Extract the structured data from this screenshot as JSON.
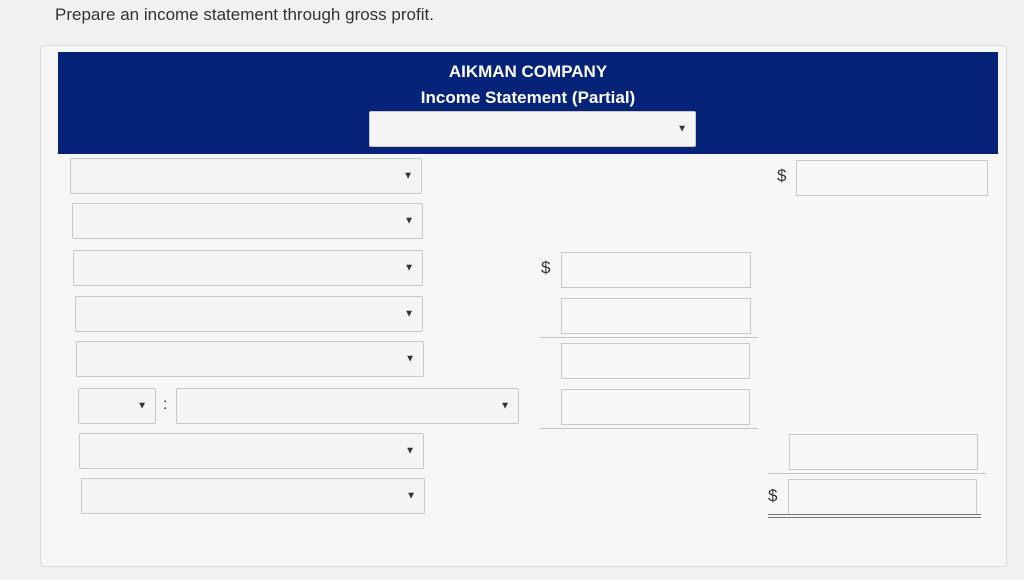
{
  "instruction": "Prepare an income statement through gross profit.",
  "statement": {
    "company": "AIKMAN COMPANY",
    "title": "Income Statement (Partial)"
  },
  "currency_symbol": "$",
  "separator": ":",
  "dropdown_caret": "▼",
  "period_select": {
    "value": ""
  },
  "rows": [
    {
      "label_value": "",
      "amount": ""
    },
    {
      "label_value": "",
      "amount": ""
    },
    {
      "label_value": "",
      "amount": ""
    },
    {
      "label_value": "",
      "amount": ""
    },
    {
      "label_value": "",
      "amount": ""
    },
    {
      "prefix_value": "",
      "label_value": "",
      "amount": ""
    },
    {
      "label_value": "",
      "amount": ""
    },
    {
      "label_value": "",
      "amount": ""
    }
  ]
}
